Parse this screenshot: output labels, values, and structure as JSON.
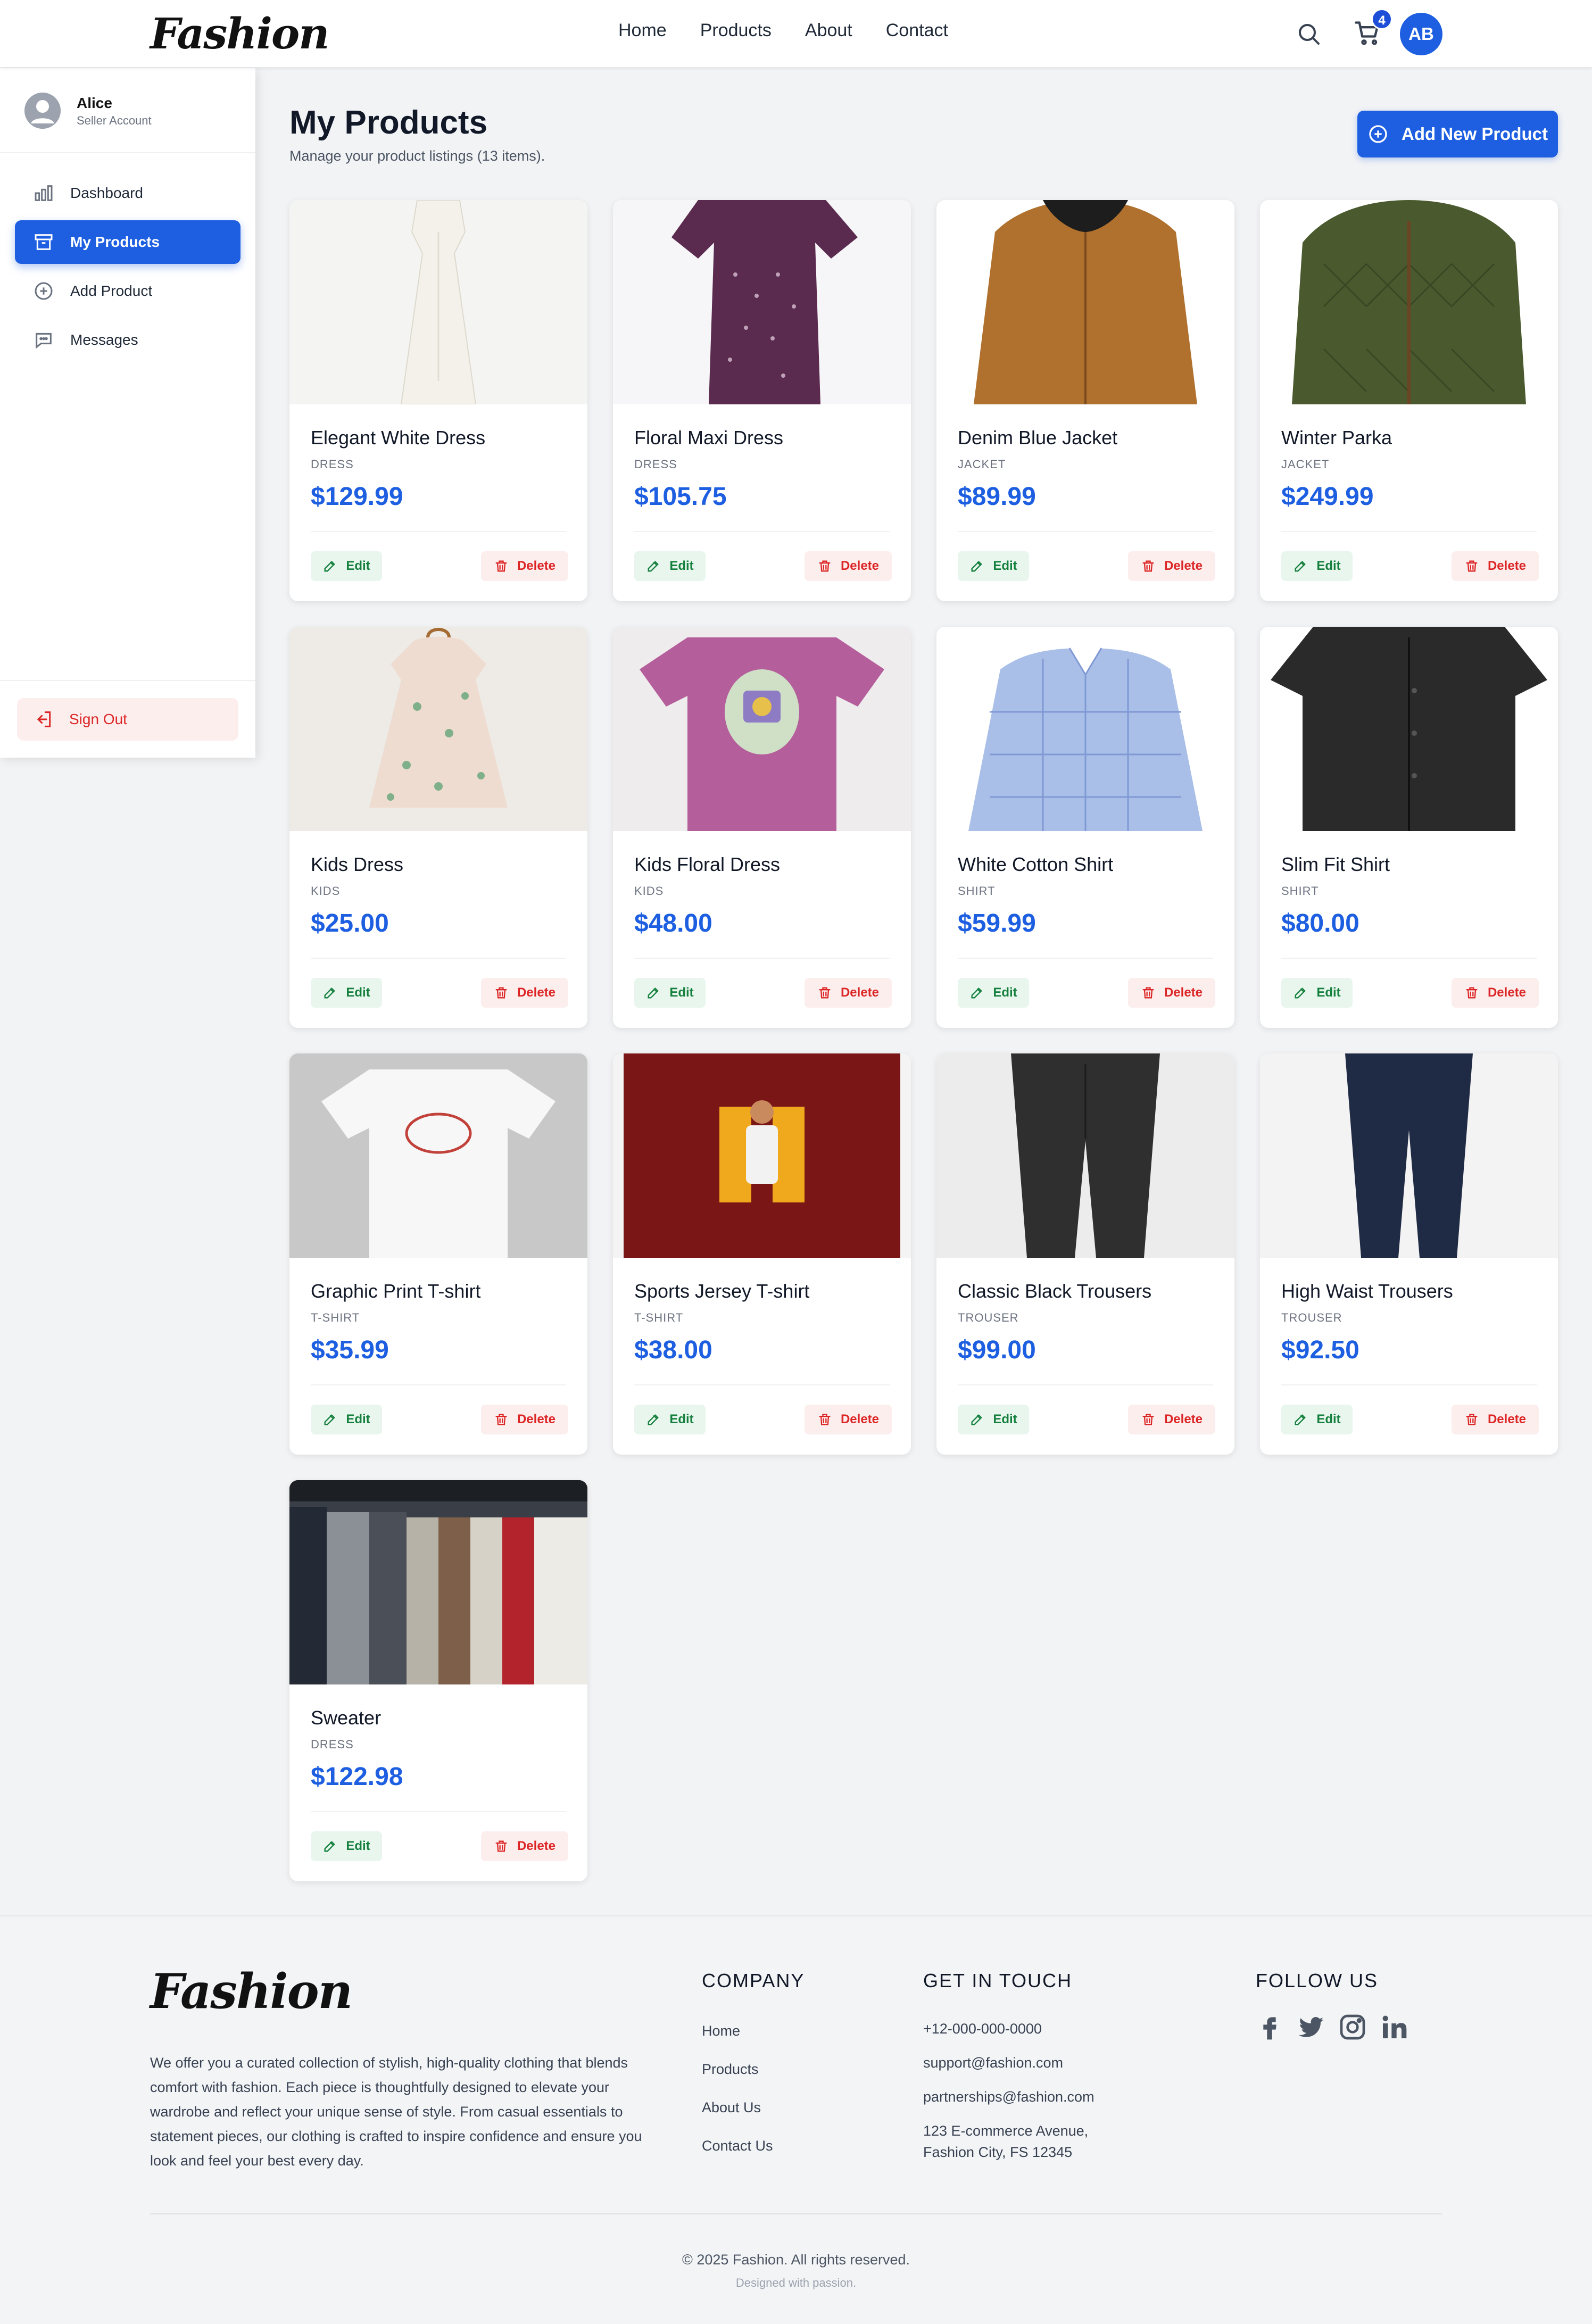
{
  "header": {
    "logo": "Fashion",
    "nav": [
      "Home",
      "Products",
      "About",
      "Contact"
    ],
    "cart_count": "4",
    "avatar_initials": "AB"
  },
  "sidebar": {
    "user_name": "Alice",
    "user_role": "Seller Account",
    "items": [
      {
        "label": "Dashboard",
        "icon": "bar-chart-icon"
      },
      {
        "label": "My Products",
        "icon": "archive-box-icon"
      },
      {
        "label": "Add Product",
        "icon": "plus-circle-icon"
      },
      {
        "label": "Messages",
        "icon": "chat-bubble-icon"
      }
    ],
    "sign_out": "Sign Out"
  },
  "main": {
    "title": "My Products",
    "subtitle": "Manage your product listings (13 items).",
    "add_button": "Add New Product",
    "edit_label": "Edit",
    "delete_label": "Delete",
    "products": [
      {
        "name": "Elegant White Dress",
        "category": "DRESS",
        "price": "$129.99"
      },
      {
        "name": "Floral Maxi Dress",
        "category": "DRESS",
        "price": "$105.75"
      },
      {
        "name": "Denim Blue Jacket",
        "category": "JACKET",
        "price": "$89.99"
      },
      {
        "name": "Winter Parka",
        "category": "JACKET",
        "price": "$249.99"
      },
      {
        "name": "Kids Dress",
        "category": "KIDS",
        "price": "$25.00"
      },
      {
        "name": "Kids Floral Dress",
        "category": "KIDS",
        "price": "$48.00"
      },
      {
        "name": "White Cotton Shirt",
        "category": "SHIRT",
        "price": "$59.99"
      },
      {
        "name": "Slim Fit Shirt",
        "category": "SHIRT",
        "price": "$80.00"
      },
      {
        "name": "Graphic Print T-shirt",
        "category": "T-SHIRT",
        "price": "$35.99"
      },
      {
        "name": "Sports Jersey T-shirt",
        "category": "T-SHIRT",
        "price": "$38.00"
      },
      {
        "name": "Classic Black Trousers",
        "category": "TROUSER",
        "price": "$99.00"
      },
      {
        "name": "High Waist Trousers",
        "category": "TROUSER",
        "price": "$92.50"
      },
      {
        "name": "Sweater",
        "category": "DRESS",
        "price": "$122.98"
      }
    ]
  },
  "footer": {
    "logo": "Fashion",
    "about": "We offer you a curated collection of stylish, high-quality clothing that blends comfort with fashion. Each piece is thoughtfully designed to elevate your wardrobe and reflect your unique sense of style. From casual essentials to statement pieces, our clothing is crafted to inspire confidence and ensure you look and feel your best every day.",
    "company_heading": "COMPANY",
    "company_links": [
      "Home",
      "Products",
      "About Us",
      "Contact Us"
    ],
    "contact_heading": "GET IN TOUCH",
    "phone": "+12-000-000-0000",
    "email_support": "support@fashion.com",
    "email_partners": "partnerships@fashion.com",
    "address_line1": "123 E-commerce Avenue,",
    "address_line2": "Fashion City, FS 12345",
    "follow_heading": "FOLLOW US",
    "social": [
      "facebook-icon",
      "twitter-icon",
      "instagram-icon",
      "linkedin-icon"
    ],
    "copyright": "© 2025 Fashion. All rights reserved.",
    "designed": "Designed with passion."
  },
  "colors": {
    "accent": "#1d5fe0",
    "edit_green": "#15803d",
    "delete_red": "#dc2626",
    "page_bg": "#f2f3f5"
  }
}
